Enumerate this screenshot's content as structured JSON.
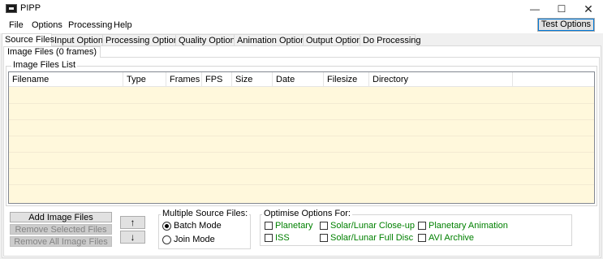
{
  "window": {
    "title": "PIPP",
    "minimize": "—",
    "maximize": "☐",
    "close": "✕"
  },
  "menu": {
    "items": [
      "File",
      "Options",
      "Processing",
      "Help"
    ],
    "test_options": "Test Options"
  },
  "tabs": [
    "Source Files",
    "Input Options",
    "Processing Options",
    "Quality Options",
    "Animation Options",
    "Output Options",
    "Do Processing"
  ],
  "subtab": "Image Files (0 frames)",
  "file_list": {
    "group_label": "Image Files List",
    "columns": [
      "Filename",
      "Type",
      "Frames",
      "FPS",
      "Size",
      "Date",
      "Filesize",
      "Directory"
    ]
  },
  "buttons": {
    "add": "Add Image Files",
    "remove_selected": "Remove Selected Files",
    "remove_all": "Remove All Image Files",
    "move_up": "↑",
    "move_down": "↓"
  },
  "multiple_source": {
    "label": "Multiple Source Files:",
    "options": [
      "Batch Mode",
      "Join Mode"
    ],
    "selected": "Batch Mode"
  },
  "optimise": {
    "label": "Optimise Options For:",
    "options": [
      "Planetary",
      "ISS",
      "Solar/Lunar Close-up",
      "Solar/Lunar Full Disc",
      "Planetary Animation",
      "AVI Archive"
    ],
    "checked": []
  },
  "colors": {
    "option_label": "#008000",
    "list_background": "#fff8dc",
    "focus_border": "#0078d7"
  }
}
